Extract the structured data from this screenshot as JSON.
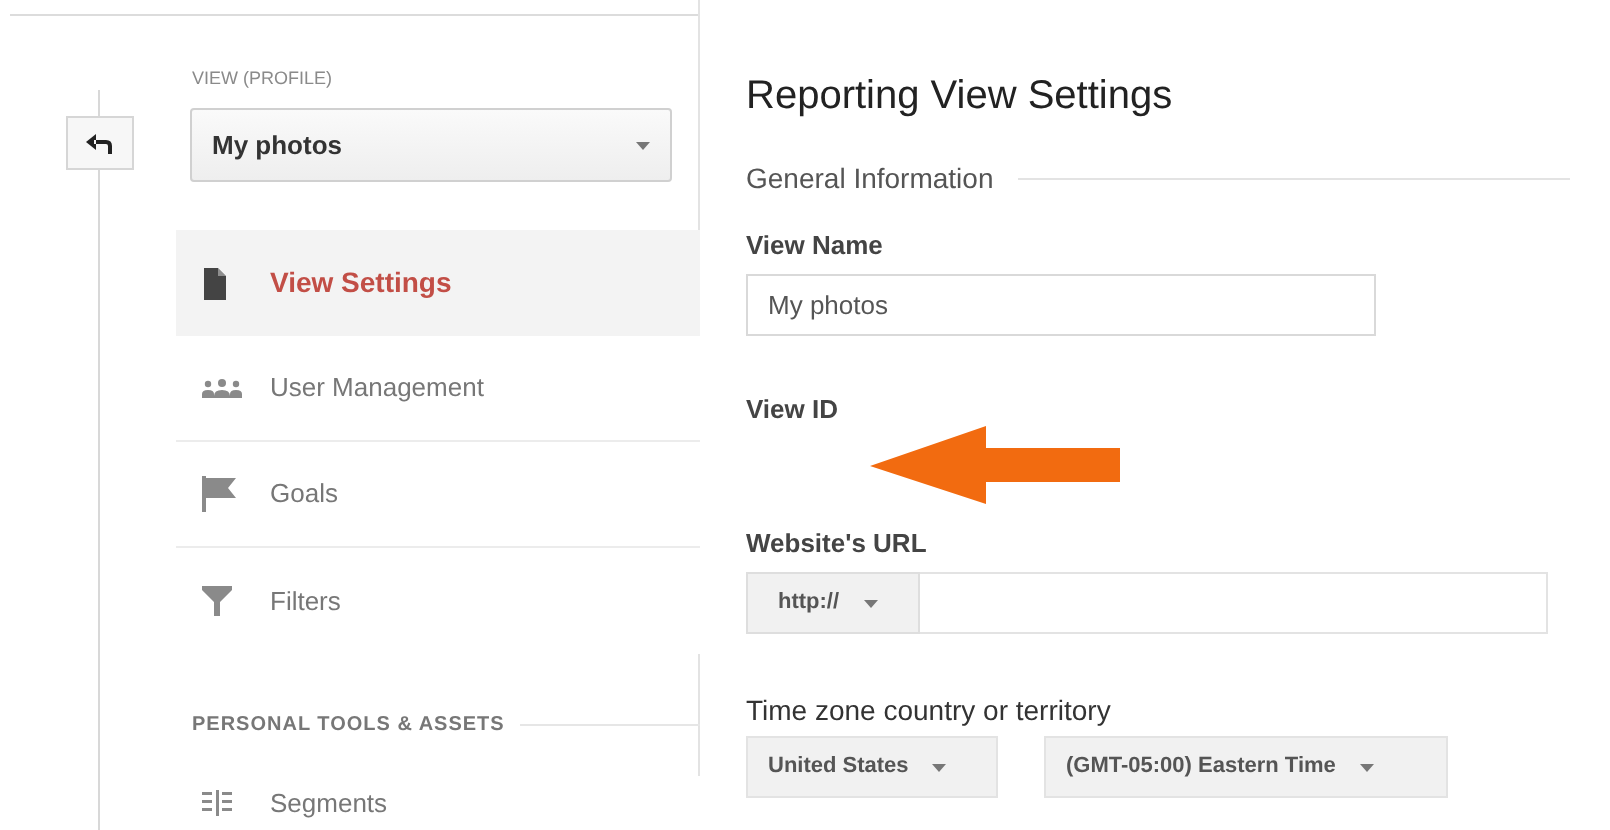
{
  "view_selector": {
    "label": "VIEW (PROFILE)",
    "value": "My photos"
  },
  "sidebar": {
    "items": [
      {
        "label": "View Settings",
        "selected": true
      },
      {
        "label": "User Management",
        "selected": false
      },
      {
        "label": "Goals",
        "selected": false
      },
      {
        "label": "Filters",
        "selected": false
      }
    ],
    "section_title": "PERSONAL TOOLS & ASSETS",
    "section_items": [
      {
        "label": "Segments",
        "selected": false
      }
    ]
  },
  "content": {
    "title": "Reporting View Settings",
    "section": "General Information",
    "view_name": {
      "label": "View Name",
      "value": "My photos"
    },
    "view_id": {
      "label": "View ID"
    },
    "website_url": {
      "label": "Website's URL",
      "protocol": "http://"
    },
    "time_zone": {
      "label": "Time zone country or territory",
      "country": "United States",
      "zone": "(GMT-05:00) Eastern Time"
    }
  }
}
